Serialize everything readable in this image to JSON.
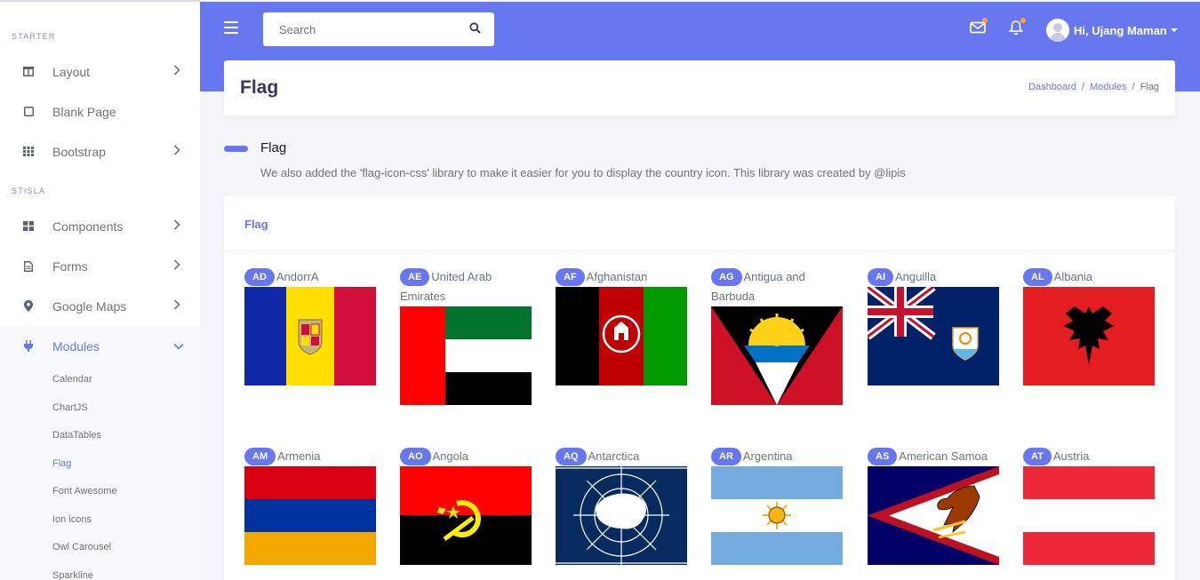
{
  "sidebar": {
    "header_starter": "STARTER",
    "header_stisla": "STISLA",
    "items": [
      {
        "label": "Layout",
        "icon": "columns-icon"
      },
      {
        "label": "Blank Page",
        "icon": "square-icon"
      },
      {
        "label": "Bootstrap",
        "icon": "grid-icon"
      },
      {
        "label": "Components",
        "icon": "th-large-icon"
      },
      {
        "label": "Forms",
        "icon": "file-icon"
      },
      {
        "label": "Google Maps",
        "icon": "map-marker-icon"
      },
      {
        "label": "Modules",
        "icon": "plug-icon"
      }
    ],
    "submenu": [
      "Calendar",
      "ChartJS",
      "DataTables",
      "Flag",
      "Font Awesome",
      "Ion icons",
      "Owl Carousel",
      "Sparkline"
    ]
  },
  "navbar": {
    "search_placeholder": "Search",
    "user_greeting": "Hi, Ujang Maman"
  },
  "header": {
    "title": "Flag",
    "breadcrumb": [
      "Dashboard",
      "Modules",
      "Flag"
    ]
  },
  "section": {
    "title": "Flag",
    "lead": "We also added the 'flag-icon-css' library to make it easier for you to display the country icon. This library was created by @lipis"
  },
  "card": {
    "title": "Flag"
  },
  "flags": [
    {
      "code": "AD",
      "name": "AndorrA"
    },
    {
      "code": "AE",
      "name": "United Arab Emirates"
    },
    {
      "code": "AF",
      "name": "Afghanistan"
    },
    {
      "code": "AG",
      "name": "Antigua and Barbuda"
    },
    {
      "code": "AI",
      "name": "Anguilla"
    },
    {
      "code": "AL",
      "name": "Albania"
    },
    {
      "code": "AM",
      "name": "Armenia"
    },
    {
      "code": "AO",
      "name": "Angola"
    },
    {
      "code": "AQ",
      "name": "Antarctica"
    },
    {
      "code": "AR",
      "name": "Argentina"
    },
    {
      "code": "AS",
      "name": "American Samoa"
    },
    {
      "code": "AT",
      "name": "Austria"
    }
  ],
  "colors": {
    "primary": "#6777ef",
    "warning": "#ffa426"
  }
}
